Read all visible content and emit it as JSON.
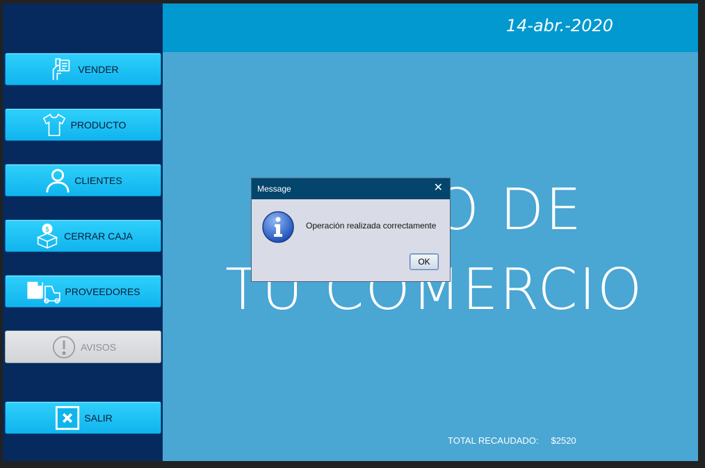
{
  "header": {
    "date": "14-abr.-2020"
  },
  "sidebar": {
    "items": [
      {
        "label": "VENDER",
        "icon": "sell-icon",
        "enabled": true
      },
      {
        "label": "PRODUCTO",
        "icon": "shirt-icon",
        "enabled": true
      },
      {
        "label": "CLIENTES",
        "icon": "user-icon",
        "enabled": true
      },
      {
        "label": "CERRAR CAJA",
        "icon": "cashbox-icon",
        "enabled": true
      },
      {
        "label": "PROVEEDORES",
        "icon": "forklift-icon",
        "enabled": true
      },
      {
        "label": "AVISOS",
        "icon": "alert-icon",
        "enabled": false
      },
      {
        "label": "SALIR",
        "icon": "close-icon",
        "enabled": true
      }
    ]
  },
  "main": {
    "watermark_line1": "GO DE",
    "watermark_line2": "TU COMERCIO",
    "total_label": "TOTAL RECAUDADO:",
    "total_value": "$2520"
  },
  "dialog": {
    "title": "Message",
    "close": "✕",
    "message": "Operación realizada correctamente",
    "ok_label": "OK",
    "icon": "info-icon"
  },
  "colors": {
    "sidebar": "#062a5e",
    "topbar": "#0199cf",
    "main": "#4aa6d3",
    "button": "#10b4ee",
    "dialog_title": "#03456c"
  }
}
